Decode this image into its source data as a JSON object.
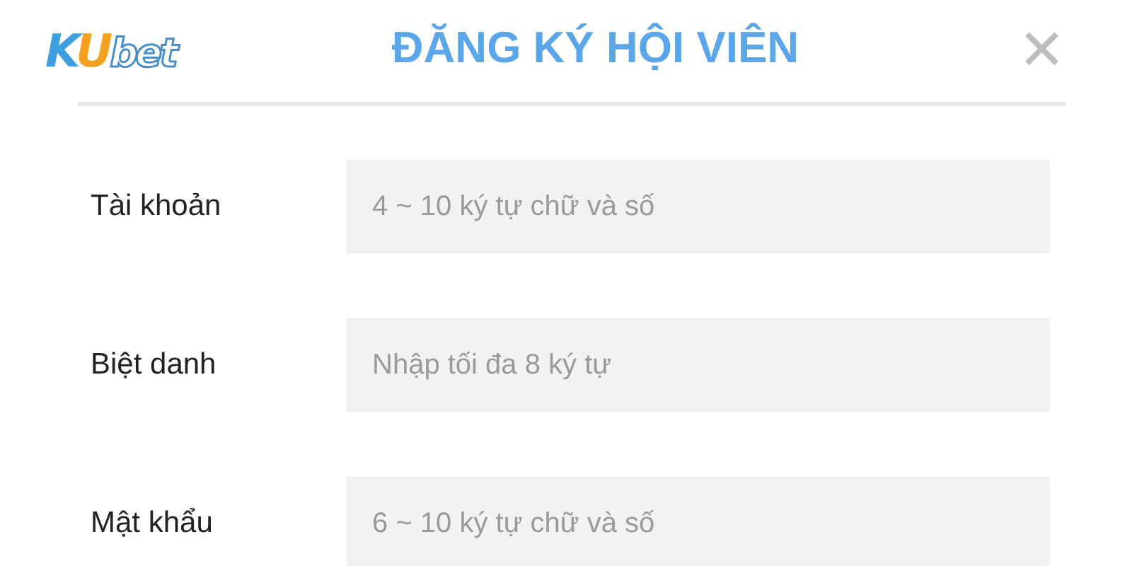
{
  "logo": {
    "letters": [
      {
        "text": "K",
        "color": "#3d9ee0"
      },
      {
        "text": "U",
        "color": "#f4a020"
      },
      {
        "text": "bet",
        "color": "#ffffff"
      }
    ]
  },
  "title": "ĐĂNG KÝ HỘI VIÊN",
  "close": {
    "symbol": "✕"
  },
  "fields": [
    {
      "label": "Tài khoản",
      "placeholder": "4 ~ 10 ký tự chữ và số"
    },
    {
      "label": "Biệt danh",
      "placeholder": "Nhập tối đa 8 ký tự"
    },
    {
      "label": "Mật khẩu",
      "placeholder": "6 ~ 10 ký tự chữ và số"
    }
  ]
}
